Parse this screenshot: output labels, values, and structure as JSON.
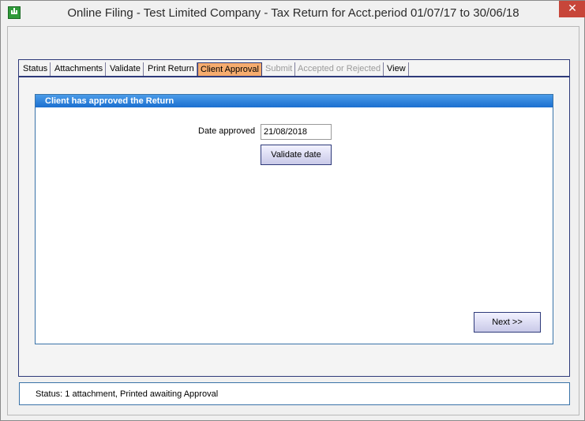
{
  "window": {
    "title": "Online Filing - Test Limited Company - Tax Return for Acct.period 01/07/17 to 30/06/18",
    "close_glyph": "✕"
  },
  "tabs": [
    {
      "label": "Status",
      "state": "normal"
    },
    {
      "label": "Attachments",
      "state": "normal"
    },
    {
      "label": "Validate",
      "state": "normal"
    },
    {
      "label": "Print Return",
      "state": "normal"
    },
    {
      "label": "Client Approval",
      "state": "active"
    },
    {
      "label": "Submit",
      "state": "disabled"
    },
    {
      "label": "Accepted or Rejected",
      "state": "disabled"
    },
    {
      "label": "View",
      "state": "normal"
    }
  ],
  "approval": {
    "header": "Client has approved the Return",
    "date_label": "Date approved",
    "date_value": "21/08/2018",
    "validate_button": "Validate date",
    "next_button": "Next >>"
  },
  "status": {
    "text": "Status: 1 attachment, Printed awaiting Approval"
  },
  "colors": {
    "active_tab": "#f6ac6e",
    "header_blue": "#1b6fd0",
    "close_red": "#c7463a"
  }
}
